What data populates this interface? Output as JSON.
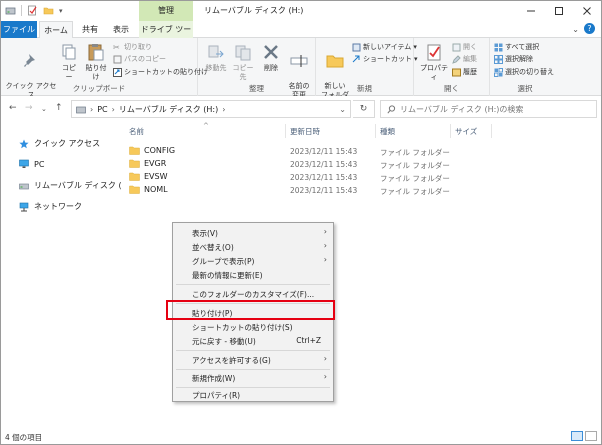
{
  "window": {
    "title": "リムーバブル ディスク (H:)",
    "context_tab": "管理"
  },
  "tabs": {
    "file": "ファイル",
    "home": "ホーム",
    "share": "共有",
    "view": "表示",
    "drive_tools": "ドライブ ツール"
  },
  "ribbon": {
    "clipboard": {
      "pin_quick_access": "クイック アクセス\nにピン留めする",
      "copy": "コピー",
      "paste": "貼り付け",
      "cut": "切り取り",
      "copy_path": "パスのコピー",
      "paste_shortcut": "ショートカットの貼り付け",
      "group_label": "クリップボード"
    },
    "organize": {
      "move_to": "移動先",
      "copy_to": "コピー先",
      "delete": "削除",
      "rename": "名前の\n変更",
      "group_label": "整理"
    },
    "new": {
      "new_folder": "新しい\nフォルダー",
      "new_item": "新しいアイテム",
      "shortcut": "ショートカット",
      "group_label": "新規"
    },
    "open": {
      "properties": "プロパティ",
      "open": "開く",
      "edit": "編集",
      "history": "履歴",
      "group_label": "開く"
    },
    "select": {
      "select_all": "すべて選択",
      "select_none": "選択解除",
      "invert_selection": "選択の切り替え",
      "group_label": "選択"
    }
  },
  "address": {
    "path": [
      "PC",
      "リムーバブル ディスク (H:)"
    ],
    "search_placeholder": "リムーバブル ディスク (H:)の検索"
  },
  "nav_pane": {
    "items": [
      "クイック アクセス",
      "PC",
      "リムーバブル ディスク (H:)",
      "ネットワーク"
    ]
  },
  "columns": {
    "name": "名前",
    "date": "更新日時",
    "type": "種類",
    "size": "サイズ"
  },
  "files": [
    {
      "name": "CONFIG",
      "date": "2023/12/11 15:43",
      "type": "ファイル フォルダー"
    },
    {
      "name": "EVGR",
      "date": "2023/12/11 15:43",
      "type": "ファイル フォルダー"
    },
    {
      "name": "EVSW",
      "date": "2023/12/11 15:43",
      "type": "ファイル フォルダー"
    },
    {
      "name": "NOML",
      "date": "2023/12/11 15:43",
      "type": "ファイル フォルダー"
    }
  ],
  "context_menu": {
    "view": "表示(V)",
    "sort_by": "並べ替え(O)",
    "group_by": "グループで表示(P)",
    "refresh": "最新の情報に更新(E)",
    "customize": "このフォルダーのカスタマイズ(F)...",
    "paste": "貼り付け(P)",
    "paste_shortcut": "ショートカットの貼り付け(S)",
    "undo_move": "元に戻す - 移動(U)",
    "undo_shortcut": "Ctrl+Z",
    "give_access": "アクセスを許可する(G)",
    "new": "新規作成(W)",
    "properties": "プロパティ(R)"
  },
  "status": {
    "item_count": "4 個の項目"
  },
  "colors": {
    "accent": "#1979ca",
    "manage_tab": "#d2e8b6",
    "highlight_box": "#e60012",
    "folder": "#f7c95a"
  }
}
